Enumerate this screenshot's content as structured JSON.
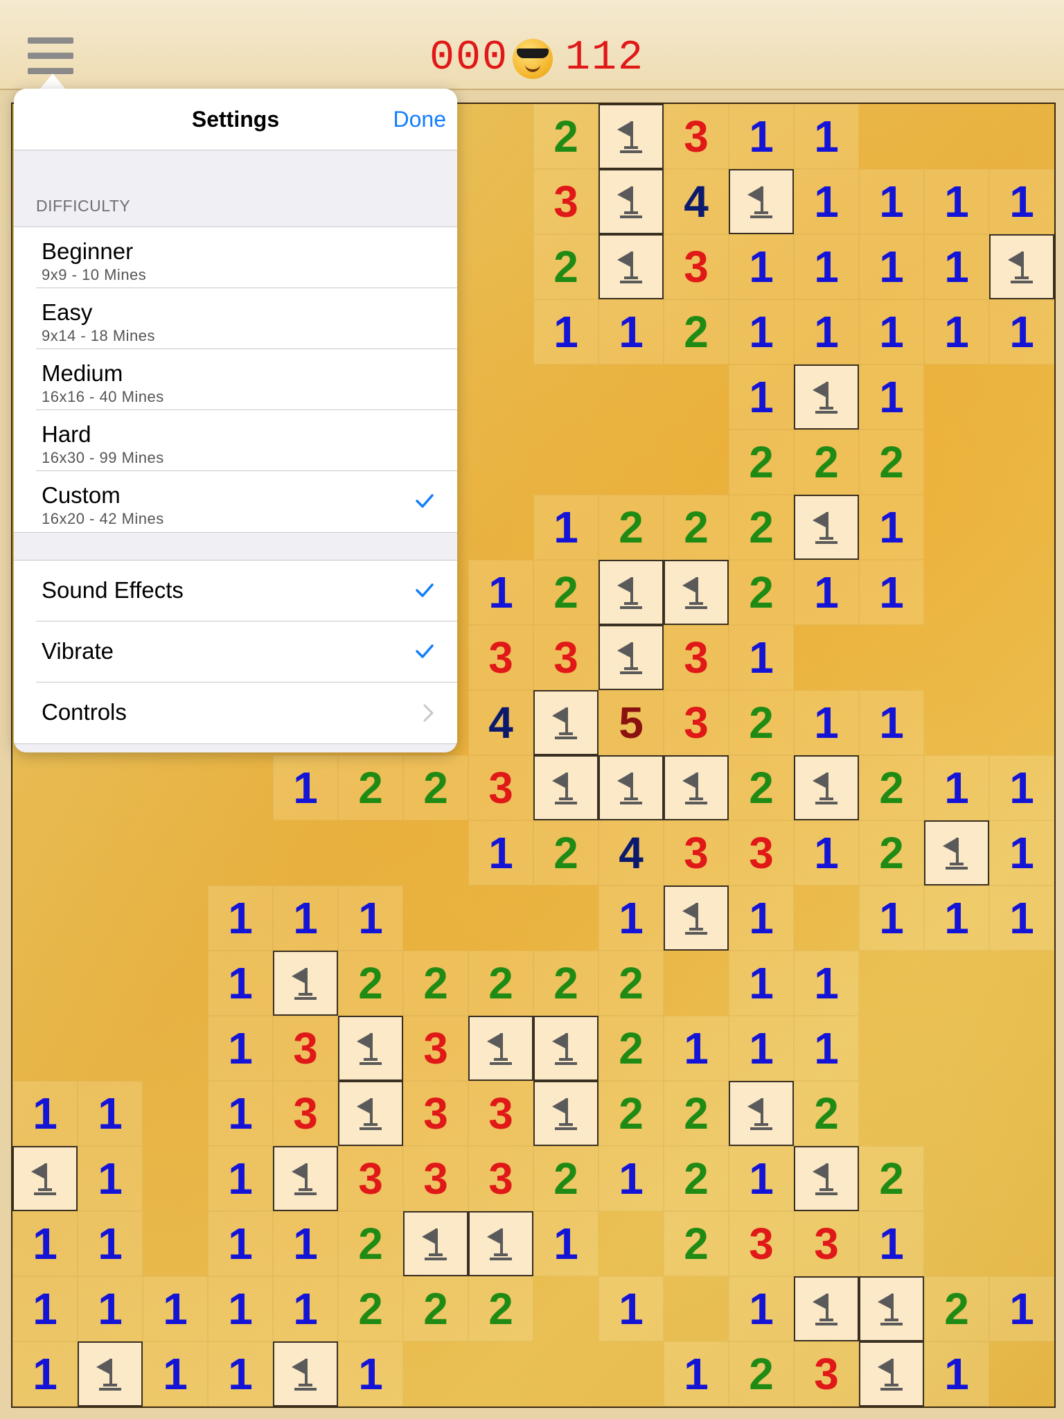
{
  "header": {
    "menu_icon": "hamburger-menu-icon",
    "mine_counter": "000",
    "face_icon": "sunglasses-smiley-icon",
    "timer": "112"
  },
  "settings": {
    "title": "Settings",
    "done_label": "Done",
    "difficulty_header": "DIFFICULTY",
    "difficulties": [
      {
        "name": "Beginner",
        "detail": "9x9 - 10 Mines",
        "selected": false
      },
      {
        "name": "Easy",
        "detail": "9x14 - 18 Mines",
        "selected": false
      },
      {
        "name": "Medium",
        "detail": "16x16 - 40 Mines",
        "selected": false
      },
      {
        "name": "Hard",
        "detail": "16x30 - 99 Mines",
        "selected": false
      },
      {
        "name": "Custom",
        "detail": "16x20 - 42 Mines",
        "selected": true
      }
    ],
    "options": [
      {
        "name": "Sound Effects",
        "checked": true
      },
      {
        "name": "Vibrate",
        "checked": true
      },
      {
        "name": "Controls",
        "disclosure": true
      }
    ],
    "accent_color": "#147efb"
  },
  "board": {
    "columns": 16,
    "rows": 20,
    "legend": "F = flagged mine, digit = adjacent mine count, '.' = revealed empty / hidden under popover",
    "grid": [
      "......... 2F311..",
      "",
      ""
    ],
    "cells": [
      "....... 2F311...",
      "....... 3F4F1111",
      "....... 2F31111F",
      "....... 11211111",
      "...........1F1...",
      "...........222...",
      "........1222F1...",
      ".......12FF211...",
      ".......33F31.....",
      ".......4F53211...",
      "....1223FFF2F211",
      ".......1243312F1",
      "...111...1F1.111",
      "...1F22222 11....",
      "...13F3FF2111....",
      "11.13F33F22F2....",
      "F1.1F3332121F2...",
      "11.112FF1.2331..",
      "11111222 1.1FF21",
      "1F11F1....123F1."
    ],
    "number_colors": {
      "1": "#1414d6",
      "2": "#1f8a14",
      "3": "#e01818",
      "4": "#0c1a6e",
      "5": "#8b1010"
    },
    "flag_icon": "flag-icon"
  }
}
